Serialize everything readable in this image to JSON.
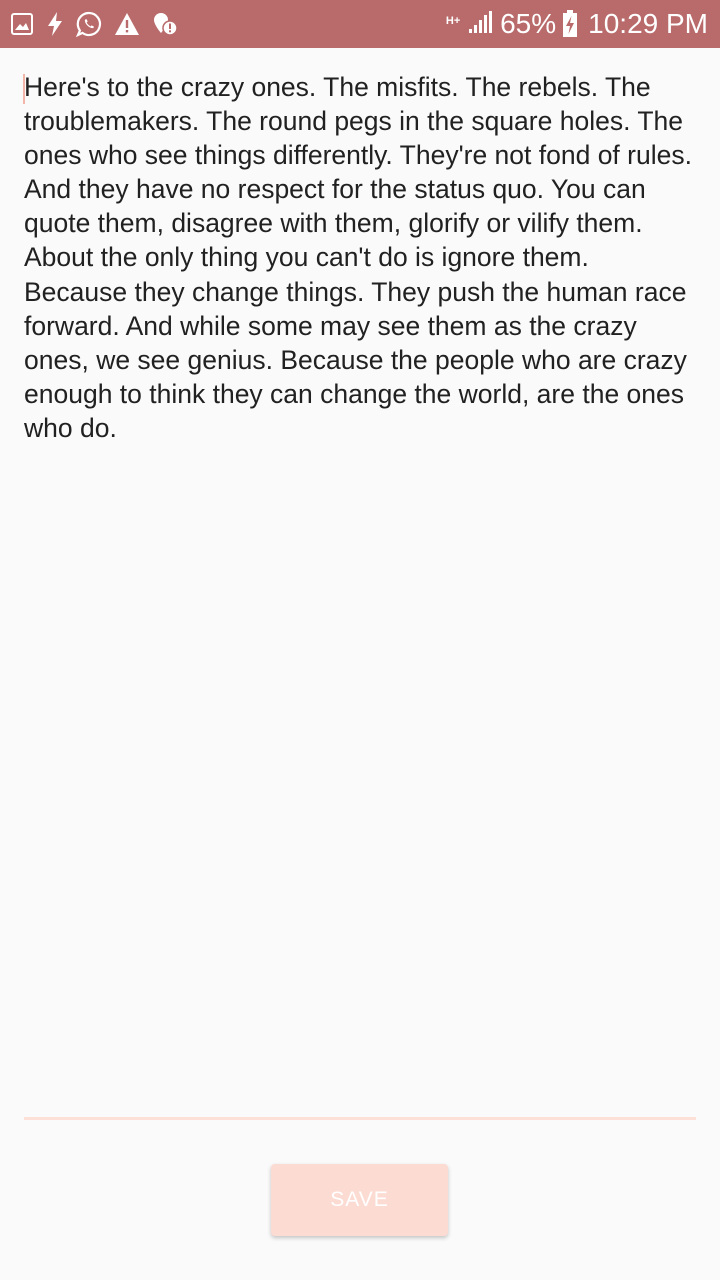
{
  "status_bar": {
    "icons_left": [
      "gallery-icon",
      "flash-icon",
      "whatsapp-icon",
      "warning-icon",
      "location-alert-icon"
    ],
    "network_type": "H+",
    "battery_percent": "65%",
    "time": "10:29 PM",
    "background_color": "#b96a6a"
  },
  "editor": {
    "text": "Here's to the crazy ones. The misfits. The rebels. The troublemakers. The round pegs in the square holes. The ones who see things differently. They're not fond of rules. And they have no respect for the status quo. You can quote them, disagree with them, glorify or vilify them. About the only thing you can't do is ignore them. Because they change things. They push the human race forward. And while some may see them as the crazy ones, we see genius. Because the people who are crazy enough to think they can change the world, are the ones who do.",
    "accent_color": "#fde0d8"
  },
  "actions": {
    "save_label": "SAVE",
    "button_color": "#fcdbd3"
  }
}
